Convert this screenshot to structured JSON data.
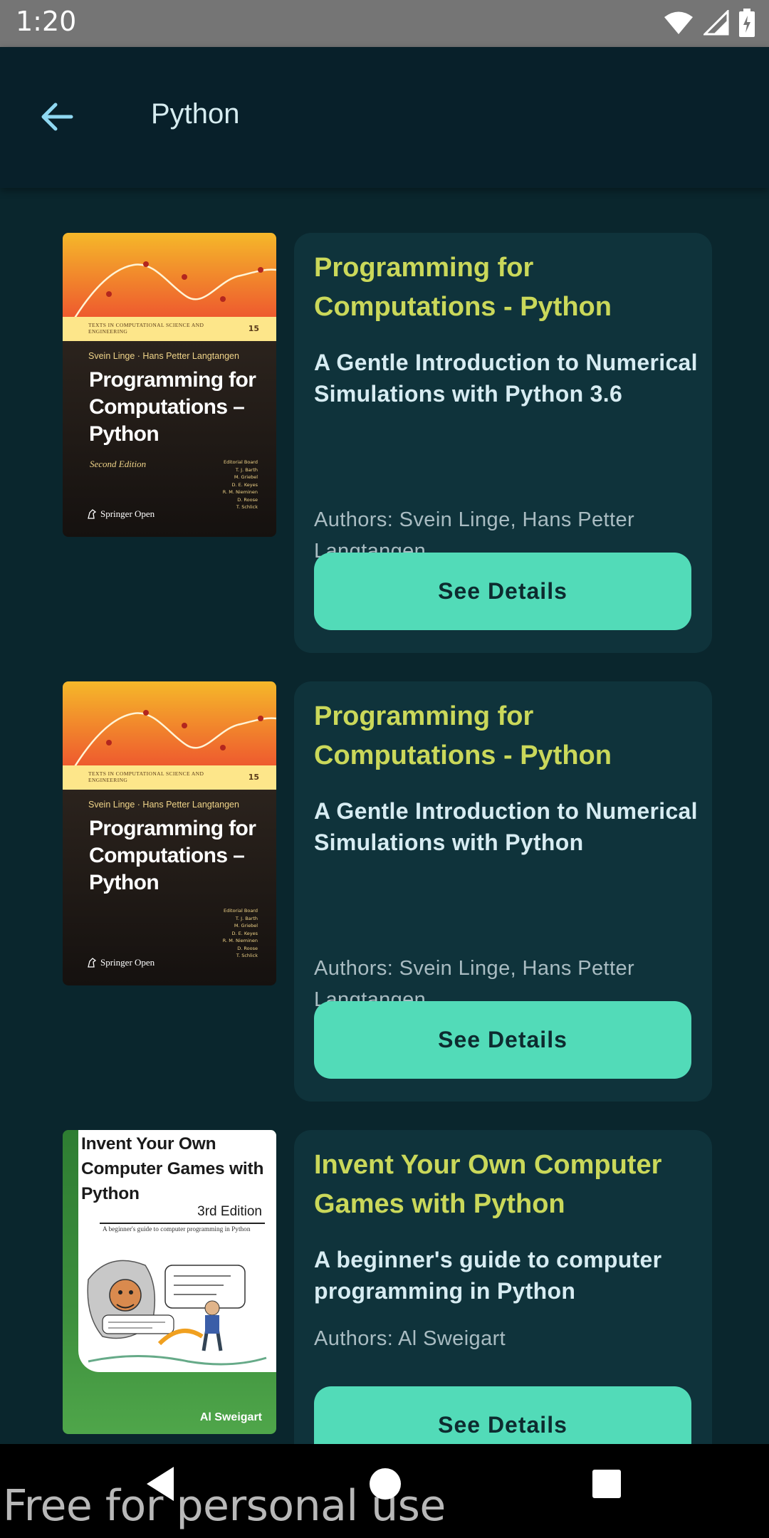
{
  "status_bar": {
    "time": "1:20",
    "icons": [
      "wifi-icon",
      "cellular-signal-icon",
      "battery-icon"
    ]
  },
  "app_bar": {
    "title": "Python",
    "back_icon": "arrow-left-icon"
  },
  "colors": {
    "background": "#0a262d",
    "card": "#0f333b",
    "title_accent": "#cad85a",
    "button": "#52dbb8"
  },
  "books": [
    {
      "title": "Programming for Computations - Python",
      "subtitle": "A Gentle Introduction to Numerical Simulations with Python 3.6",
      "authors": "Authors: Svein Linge, Hans Petter Langtangen",
      "button_label": "See Details",
      "cover": {
        "series": "TEXTS IN COMPUTATIONAL SCIENCE AND ENGINEERING",
        "series_number": "15",
        "authors": "Svein Linge · Hans Petter Langtangen",
        "title": "Programming for Computations – Python",
        "edition": "Second Edition",
        "board": [
          "Editorial Board",
          "T. J. Barth",
          "M. Griebel",
          "D. E. Keyes",
          "R. M. Nieminen",
          "D. Roose",
          "T. Schlick"
        ],
        "publisher": "Springer Open"
      }
    },
    {
      "title": "Programming for Computations - Python",
      "subtitle": "A Gentle Introduction to Numerical Simulations with Python",
      "authors": "Authors: Svein Linge, Hans Petter Langtangen",
      "button_label": "See Details",
      "cover": {
        "series": "TEXTS IN COMPUTATIONAL SCIENCE AND ENGINEERING",
        "series_number": "15",
        "authors": "Svein Linge · Hans Petter Langtangen",
        "title": "Programming for Computations – Python",
        "board": [
          "Editorial Board",
          "T. J. Barth",
          "M. Griebel",
          "D. E. Keyes",
          "R. M. Nieminen",
          "D. Roose",
          "T. Schlick"
        ],
        "publisher": "Springer Open"
      }
    },
    {
      "title": "Invent Your Own Computer Games with Python",
      "subtitle": "A beginner's guide to computer programming in Python",
      "authors": "Authors: Al Sweigart",
      "button_label": "See Details",
      "cover": {
        "title": "Invent Your Own Computer Games with Python",
        "edition": "3rd Edition",
        "tagline": "A beginner's guide to computer programming in Python",
        "author": "Al Sweigart"
      }
    }
  ],
  "nav_bar": {
    "icons": [
      "back-triangle-icon",
      "home-circle-icon",
      "recents-square-icon"
    ]
  },
  "watermark": "Free for personal use"
}
